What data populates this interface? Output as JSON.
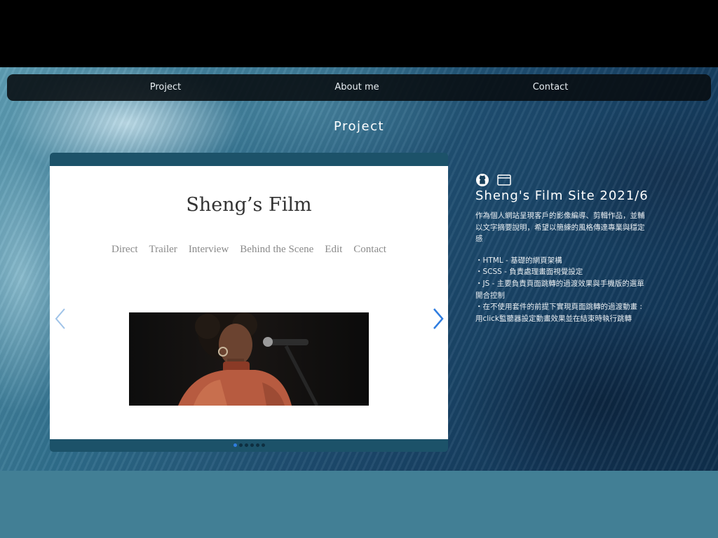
{
  "nav": {
    "items": [
      "Project",
      "About me",
      "Contact"
    ]
  },
  "section_title": "Project",
  "preview": {
    "site_title": "Sheng’s Film",
    "menu": [
      "Direct",
      "Trailer",
      "Interview",
      "Behind the Scene",
      "Edit",
      "Contact"
    ],
    "slide_count": 6,
    "active_slide": 1,
    "colors": {
      "card_frame": "#1c5269",
      "arrow": "#2f7de0",
      "dot_active": "#2f7de0"
    }
  },
  "info": {
    "icons": [
      "github-icon",
      "browser-window-icon"
    ],
    "title": "Sheng's Film Site 2021/6",
    "description": "作為個人網站呈現客戶的影像編導、剪輯作品，並輔以文字摘要說明，希望以簡練的風格傳達專業與穩定感",
    "features": [
      "・HTML - 基礎的網頁架構",
      "・SCSS - 負責處理畫面視覺設定",
      "・JS - 主要負責頁面跳轉的過渡效果與手機版的選單開合控制",
      "・在不使用套件的前提下實現頁面跳轉的過渡動畫 : 用click監聽器設定動畫效果並在結束時執行跳轉"
    ]
  }
}
